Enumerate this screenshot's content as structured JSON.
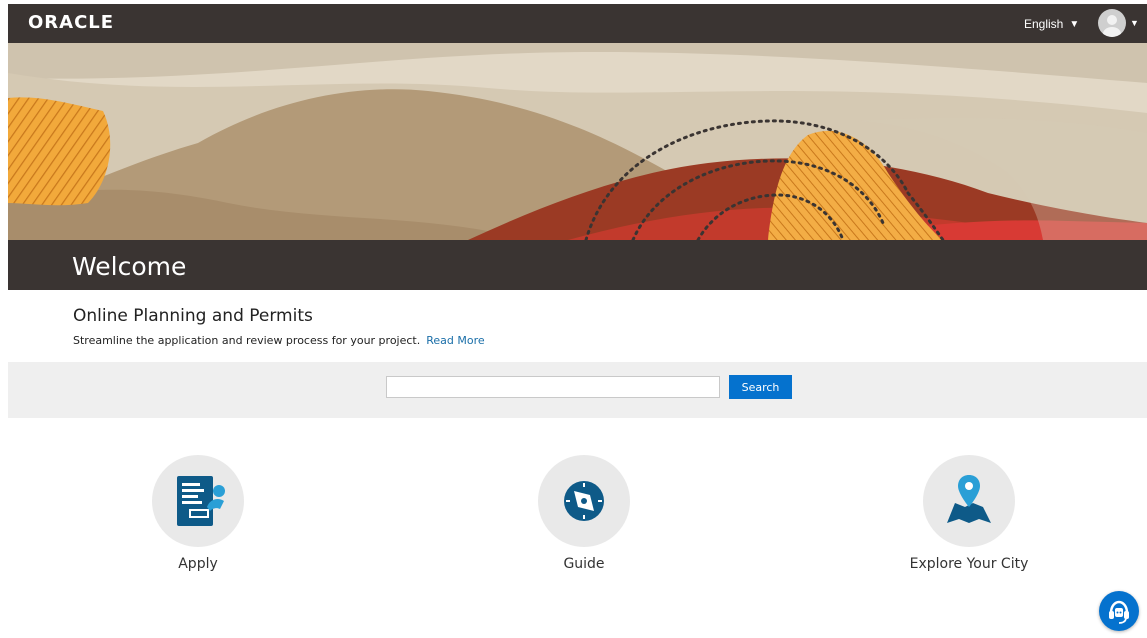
{
  "header": {
    "logo_text": "ORACLE",
    "language": "English"
  },
  "banner": {
    "title": "Welcome"
  },
  "intro": {
    "title": "Online Planning and Permits",
    "description": "Streamline the application and review process for your project.",
    "read_more": "Read More"
  },
  "search": {
    "placeholder": "",
    "button_label": "Search"
  },
  "tiles": [
    {
      "label": "Apply",
      "icon": "apply-form-icon"
    },
    {
      "label": "Guide",
      "icon": "compass-icon"
    },
    {
      "label": "Explore Your City",
      "icon": "map-pin-icon"
    }
  ],
  "colors": {
    "header_bg": "#3a3432",
    "accent": "#0572ce",
    "link": "#1a6ea8",
    "tile_icon": "#0e5a88"
  }
}
